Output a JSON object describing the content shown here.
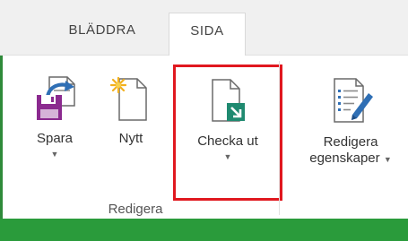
{
  "tabs": [
    {
      "label": "BLÄDDRA"
    },
    {
      "label": "SIDA",
      "selected": true
    }
  ],
  "ribbon": {
    "buttons": {
      "save": {
        "label": "Spara",
        "has_dropdown": true,
        "icon": "save-icon"
      },
      "new": {
        "label": "Nytt",
        "has_dropdown": false,
        "icon": "new-document-icon"
      },
      "checkout": {
        "label": "Checka ut",
        "has_dropdown": true,
        "icon": "checkout-icon",
        "highlighted": true
      },
      "edit_properties": {
        "label_line1": "Redigera",
        "label_line2": "egenskaper",
        "has_dropdown": true,
        "icon": "edit-properties-icon"
      }
    },
    "group_label": "Redigera"
  },
  "colors": {
    "accent_green": "#2a9b3b",
    "highlight_red": "#e0181f",
    "save_purple": "#8b2a8f",
    "save_blue": "#2f6fb5",
    "checkout_teal": "#1f8a70"
  }
}
